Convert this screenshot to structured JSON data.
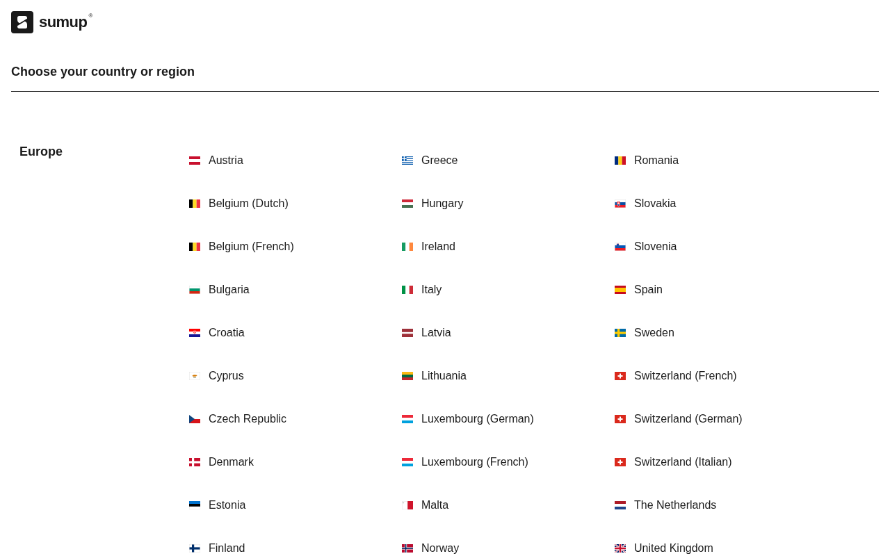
{
  "header": {
    "logo": {
      "wordmark": "sumup",
      "mark": "®"
    }
  },
  "title": "Choose your country or region",
  "regions": [
    {
      "name": "Europe",
      "countries": [
        {
          "label": "Austria",
          "kind": "at"
        },
        {
          "label": "Belgium (Dutch)",
          "kind": "be"
        },
        {
          "label": "Belgium (French)",
          "kind": "be"
        },
        {
          "label": "Bulgaria",
          "kind": "bg"
        },
        {
          "label": "Croatia",
          "kind": "hr"
        },
        {
          "label": "Cyprus",
          "kind": "cy"
        },
        {
          "label": "Czech Republic",
          "kind": "cz"
        },
        {
          "label": "Denmark",
          "kind": "dk"
        },
        {
          "label": "Estonia",
          "kind": "ee"
        },
        {
          "label": "Finland",
          "kind": "fi"
        },
        {
          "label": "Greece",
          "kind": "gr"
        },
        {
          "label": "Hungary",
          "kind": "hu"
        },
        {
          "label": "Ireland",
          "kind": "ie"
        },
        {
          "label": "Italy",
          "kind": "it"
        },
        {
          "label": "Latvia",
          "kind": "lv"
        },
        {
          "label": "Lithuania",
          "kind": "lt"
        },
        {
          "label": "Luxembourg (German)",
          "kind": "lu"
        },
        {
          "label": "Luxembourg (French)",
          "kind": "lu"
        },
        {
          "label": "Malta",
          "kind": "mt"
        },
        {
          "label": "Norway",
          "kind": "no"
        },
        {
          "label": "Romania",
          "kind": "ro"
        },
        {
          "label": "Slovakia",
          "kind": "sk"
        },
        {
          "label": "Slovenia",
          "kind": "si"
        },
        {
          "label": "Spain",
          "kind": "es"
        },
        {
          "label": "Sweden",
          "kind": "se"
        },
        {
          "label": "Switzerland (French)",
          "kind": "ch"
        },
        {
          "label": "Switzerland (German)",
          "kind": "ch"
        },
        {
          "label": "Switzerland (Italian)",
          "kind": "ch"
        },
        {
          "label": "The Netherlands",
          "kind": "nl"
        },
        {
          "label": "United Kingdom",
          "kind": "gb"
        }
      ]
    }
  ]
}
